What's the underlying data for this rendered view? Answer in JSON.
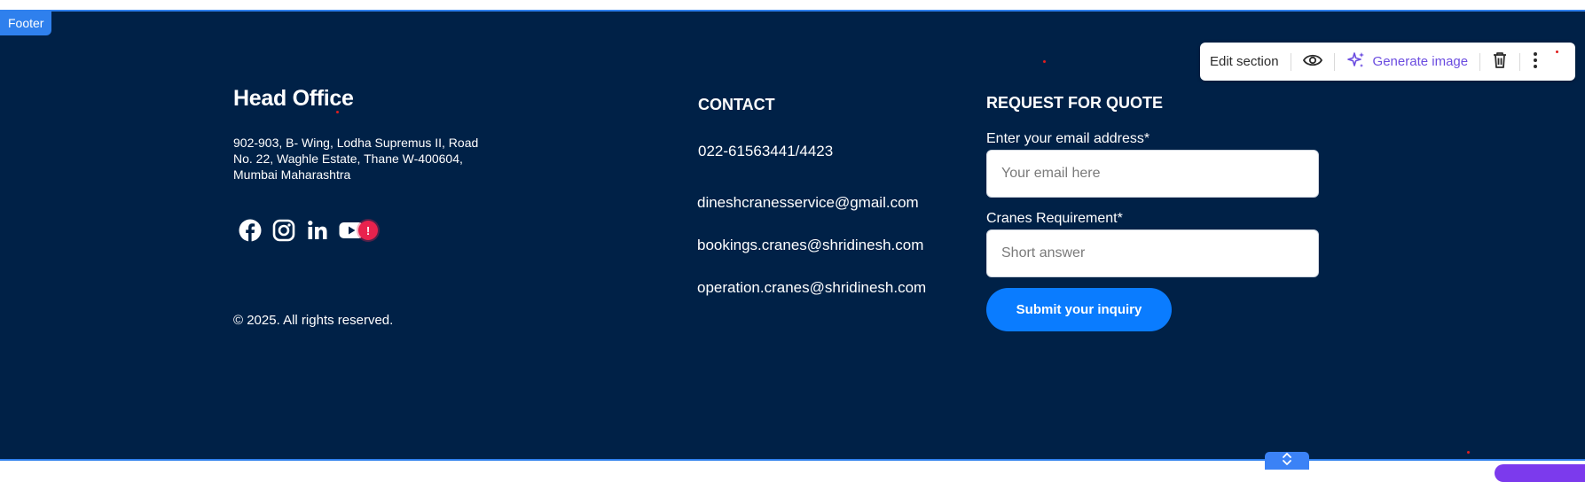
{
  "section": {
    "tag": "Footer"
  },
  "toolbar": {
    "edit_label": "Edit section",
    "generate_label": "Generate image",
    "icons": [
      "eye-icon",
      "sparkle-icon",
      "trash-icon",
      "more-vertical-icon"
    ]
  },
  "head_office": {
    "title": "Head Office",
    "address": "902-903, B- Wing, Lodha Supremus II, Road No. 22, Waghle Estate, Thane W-400604, Mumbai Maharashtra",
    "socials": [
      "facebook-icon",
      "instagram-icon",
      "linkedin-icon",
      "youtube-icon"
    ],
    "alert_badge": "!",
    "copyright": "© 2025. All rights reserved."
  },
  "contact": {
    "title": "CONTACT",
    "phone": "022-61563441/4423",
    "emails": [
      "dineshcranesservice@gmail.com",
      "bookings.cranes@shridinesh.com",
      "operation.cranes@shridinesh.com"
    ]
  },
  "quote": {
    "title": "REQUEST FOR QUOTE",
    "email_label": "Enter your email address*",
    "email_placeholder": "Your email here",
    "email_value": "",
    "cranes_label": "Cranes Requirement*",
    "cranes_placeholder": "Short answer",
    "cranes_value": "",
    "submit_label": "Submit your inquiry"
  },
  "colors": {
    "background": "#002147",
    "accent": "#0a7cff",
    "selection_border": "#2f80ed",
    "generate_text": "#6b4ce0",
    "alert": "#e8224d"
  }
}
